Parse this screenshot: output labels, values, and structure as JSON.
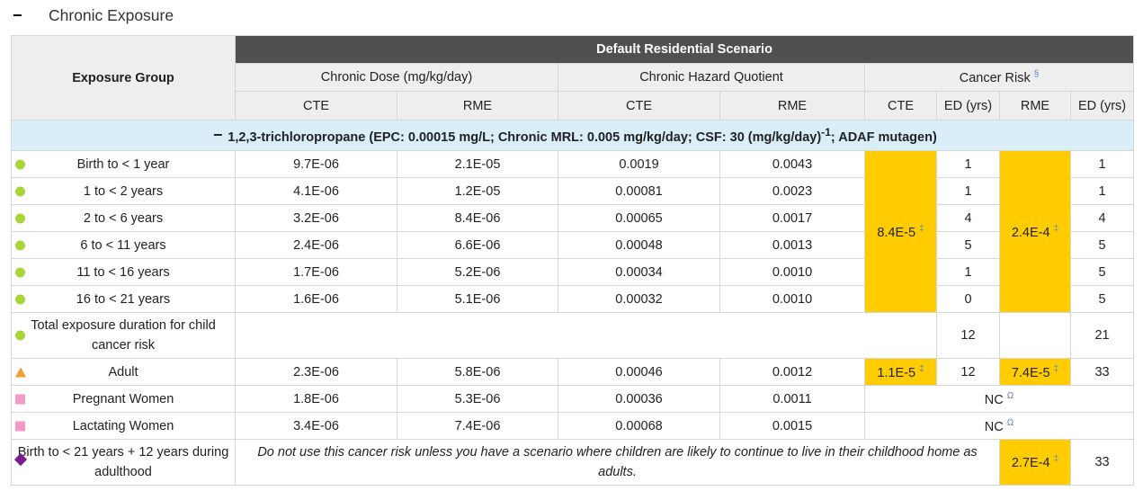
{
  "section": {
    "toggle": "−",
    "title": "Chronic Exposure"
  },
  "headers": {
    "exposure_group": "Exposure Group",
    "scenario": "Default Residential Scenario",
    "chronic_dose": "Chronic Dose (mg/kg/day)",
    "hazard_quotient": "Chronic Hazard Quotient",
    "cancer_risk": "Cancer Risk",
    "cancer_risk_ref": "§",
    "cte": "CTE",
    "rme": "RME",
    "ed_yrs": "ED (yrs)"
  },
  "chemical": {
    "toggle": "−",
    "label_pre": "1,2,3-trichloropropane (EPC: 0.00015 mg/L; Chronic MRL: 0.005 mg/kg/day; CSF: 30 (mg/kg/day)",
    "label_sup": "-1",
    "label_post": "; ADAF mutagen)"
  },
  "child_rows": [
    {
      "group": "Birth to < 1 year",
      "dose_cte": "9.7E-06",
      "dose_rme": "2.1E-05",
      "hq_cte": "0.0019",
      "hq_rme": "0.0043",
      "ed_cte": "1",
      "ed_rme": "1"
    },
    {
      "group": "1 to < 2 years",
      "dose_cte": "4.1E-06",
      "dose_rme": "1.2E-05",
      "hq_cte": "0.00081",
      "hq_rme": "0.0023",
      "ed_cte": "1",
      "ed_rme": "1"
    },
    {
      "group": "2 to < 6 years",
      "dose_cte": "3.2E-06",
      "dose_rme": "8.4E-06",
      "hq_cte": "0.00065",
      "hq_rme": "0.0017",
      "ed_cte": "4",
      "ed_rme": "4"
    },
    {
      "group": "6 to < 11 years",
      "dose_cte": "2.4E-06",
      "dose_rme": "6.6E-06",
      "hq_cte": "0.00048",
      "hq_rme": "0.0013",
      "ed_cte": "5",
      "ed_rme": "5"
    },
    {
      "group": "11 to < 16 years",
      "dose_cte": "1.7E-06",
      "dose_rme": "5.2E-06",
      "hq_cte": "0.00034",
      "hq_rme": "0.0010",
      "ed_cte": "1",
      "ed_rme": "5"
    },
    {
      "group": "16 to < 21 years",
      "dose_cte": "1.6E-06",
      "dose_rme": "5.1E-06",
      "hq_cte": "0.00032",
      "hq_rme": "0.0010",
      "ed_cte": "0",
      "ed_rme": "5"
    }
  ],
  "child_risk": {
    "cte": "8.4E-5",
    "rme": "2.4E-4",
    "ref": "‡"
  },
  "total_row": {
    "label": "Total exposure duration for child cancer risk",
    "ed_cte": "12",
    "ed_rme": "21"
  },
  "adult_row": {
    "group": "Adult",
    "dose_cte": "2.3E-06",
    "dose_rme": "5.8E-06",
    "hq_cte": "0.00046",
    "hq_rme": "0.0012",
    "risk_cte": "1.1E-5",
    "ed_cte": "12",
    "risk_rme": "7.4E-5",
    "ed_rme": "33",
    "ref": "‡"
  },
  "pregnant_row": {
    "group": "Pregnant Women",
    "dose_cte": "1.8E-06",
    "dose_rme": "5.3E-06",
    "hq_cte": "0.00036",
    "hq_rme": "0.0011",
    "cancer": "NC",
    "ref": "Ω"
  },
  "lactating_row": {
    "group": "Lactating Women",
    "dose_cte": "3.4E-06",
    "dose_rme": "7.4E-06",
    "hq_cte": "0.00068",
    "hq_rme": "0.0015",
    "cancer": "NC",
    "ref": "Ω"
  },
  "lifetime_row": {
    "group": "Birth to < 21 years + 12 years during adulthood",
    "note": "Do not use this cancer risk unless you have a scenario where children are likely to continue to live in their childhood home as adults.",
    "risk_rme": "2.7E-4",
    "ref": "‡",
    "ed_rme": "33"
  },
  "colors": {
    "banner": "#505050",
    "header_bg": "#eeeeee",
    "chemical_bg": "#d9eef6",
    "risk_highlight": "#ffcc00",
    "child_marker": "#a7d63a",
    "adult_marker": "#f0a030",
    "women_marker": "#f49ac8",
    "lifetime_marker": "#7a1b8f"
  }
}
